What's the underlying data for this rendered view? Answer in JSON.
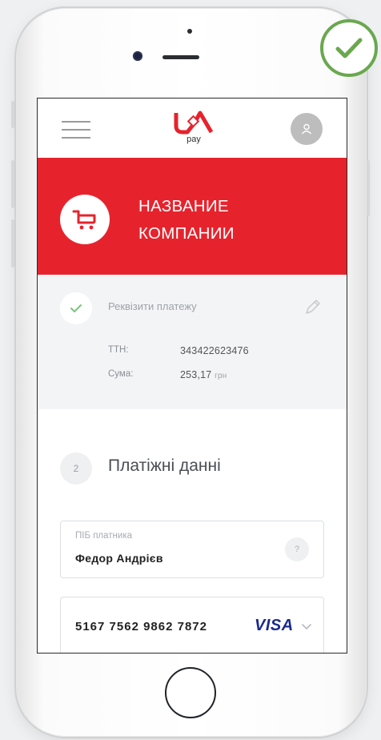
{
  "app": {
    "logo_sub": "pay"
  },
  "header": {
    "company_line1": "НАЗВАНИЕ",
    "company_line2": "КОМПАНИИ"
  },
  "payment_details": {
    "title": "Реквізити платежу",
    "rows": [
      {
        "label": "ТТН:",
        "value": "343422623476",
        "unit": ""
      },
      {
        "label": "Сума:",
        "value": "253,17",
        "unit": "грн"
      }
    ]
  },
  "step2": {
    "number": "2",
    "title": "Платіжні данні"
  },
  "payer_field": {
    "label": "ПІБ платника",
    "value": "Федор Андрієв",
    "help": "?"
  },
  "card_field": {
    "number": "5167 7562 9862 7872",
    "brand": "VISA"
  },
  "colors": {
    "brand_red": "#e6232d",
    "verified_green": "#6aa84f",
    "visa_blue": "#1a2b8c"
  },
  "icons": [
    "menu-icon",
    "logo-icon",
    "user-icon",
    "cart-icon",
    "check-icon",
    "pencil-icon",
    "chevron-down-icon",
    "verified-check-icon"
  ]
}
